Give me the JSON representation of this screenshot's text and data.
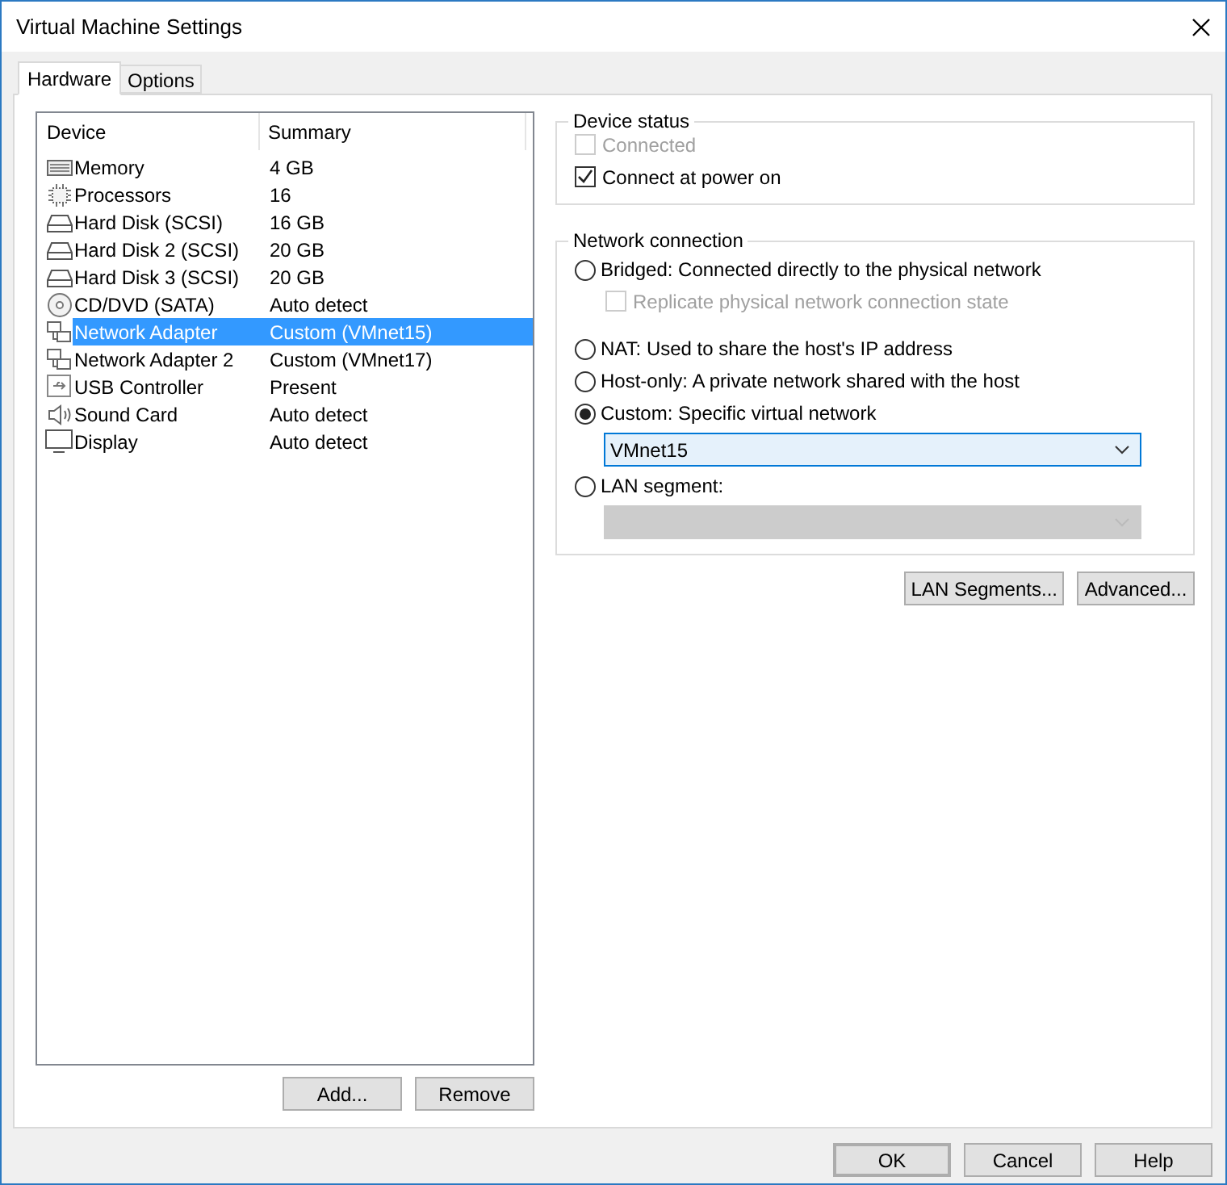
{
  "window": {
    "title": "Virtual Machine Settings"
  },
  "tabs": [
    {
      "label": "Hardware",
      "selected": true
    },
    {
      "label": "Options",
      "selected": false
    }
  ],
  "device_list": {
    "columns": [
      "Device",
      "Summary"
    ],
    "rows": [
      {
        "kind": "memory",
        "device": "Memory",
        "summary": "4 GB",
        "selected": false
      },
      {
        "kind": "cpu",
        "device": "Processors",
        "summary": "16",
        "selected": false
      },
      {
        "kind": "disk",
        "device": "Hard Disk (SCSI)",
        "summary": "16 GB",
        "selected": false
      },
      {
        "kind": "disk",
        "device": "Hard Disk 2 (SCSI)",
        "summary": "20 GB",
        "selected": false
      },
      {
        "kind": "disk",
        "device": "Hard Disk 3 (SCSI)",
        "summary": "20 GB",
        "selected": false
      },
      {
        "kind": "disc",
        "device": "CD/DVD (SATA)",
        "summary": "Auto detect",
        "selected": false
      },
      {
        "kind": "network",
        "device": "Network Adapter",
        "summary": "Custom (VMnet15)",
        "selected": true
      },
      {
        "kind": "network",
        "device": "Network Adapter 2",
        "summary": "Custom (VMnet17)",
        "selected": false
      },
      {
        "kind": "usb",
        "device": "USB Controller",
        "summary": "Present",
        "selected": false
      },
      {
        "kind": "speaker",
        "device": "Sound Card",
        "summary": "Auto detect",
        "selected": false
      },
      {
        "kind": "monitor",
        "device": "Display",
        "summary": "Auto detect",
        "selected": false
      }
    ],
    "buttons": [
      "Add...",
      "Remove"
    ]
  },
  "device_status": {
    "title": "Device status",
    "options": [
      {
        "label": "Connected",
        "checked": false,
        "disabled": true
      },
      {
        "label": "Connect at power on",
        "checked": true,
        "disabled": false
      }
    ]
  },
  "network_connection": {
    "title": "Network connection",
    "items": [
      {
        "kind": "radio",
        "label": "Bridged: Connected directly to the physical network",
        "selected": false
      },
      {
        "kind": "checkbox",
        "label": "Replicate physical network connection state",
        "checked": false,
        "disabled": true
      },
      {
        "kind": "radio",
        "label": "NAT: Used to share the host's IP address",
        "selected": false
      },
      {
        "kind": "radio",
        "label": "Host-only: A private network shared with the host",
        "selected": false
      },
      {
        "kind": "radio",
        "label": "Custom: Specific virtual network",
        "selected": true
      },
      {
        "kind": "dropdown",
        "value": "VMnet15",
        "disabled": false
      },
      {
        "kind": "radio",
        "label": "LAN segment:",
        "selected": false
      },
      {
        "kind": "dropdown",
        "disabled": true
      }
    ]
  },
  "panel_buttons": [
    "LAN Segments...",
    "Advanced..."
  ],
  "footer_buttons": [
    {
      "label": "OK",
      "default": true
    },
    {
      "label": "Cancel",
      "default": false
    },
    {
      "label": "Help",
      "default": false
    }
  ]
}
